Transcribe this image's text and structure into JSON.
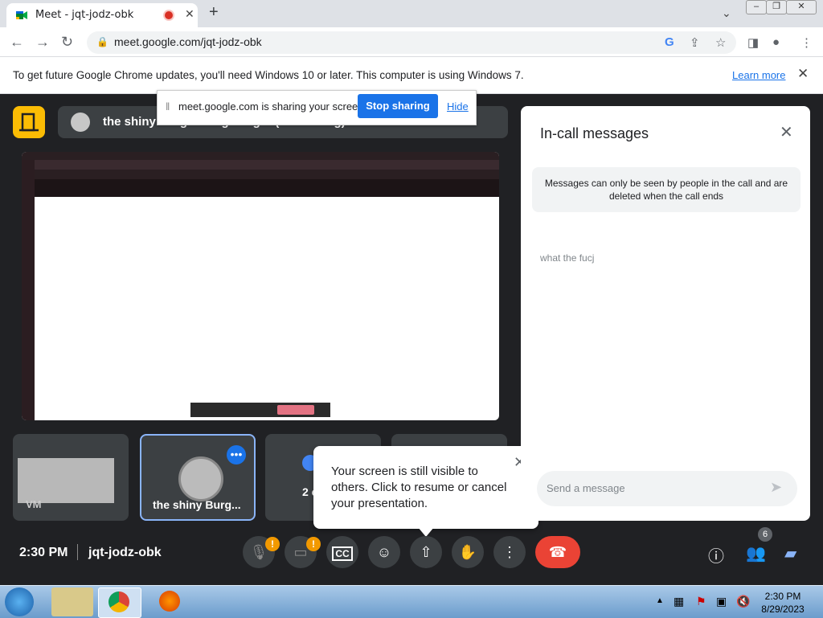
{
  "browser": {
    "tab_title": "Meet - jqt-jodz-obk",
    "new_tab_icon": "+",
    "url": "meet.google.com/jqt-jodz-obk",
    "infobar_text": "To get future Google Chrome updates, you'll need Windows 10 or later. This computer is using Windows 7.",
    "infobar_link": "Learn more"
  },
  "sharebar": {
    "text": "meet.google.com is sharing your screen.",
    "stop_label": "Stop sharing",
    "hide_label": "Hide"
  },
  "meet": {
    "presenter_name": "the shiny Burger King Burger (Presenting)",
    "tiles": [
      {
        "label": "VM"
      },
      {
        "label": "the shiny Burg..."
      },
      {
        "label": "2 c"
      }
    ],
    "popup_text": "Your screen is still visible to others. Click to resume or cancel your presentation.",
    "clock": "2:30 PM",
    "meeting_code": "jqt-jodz-obk",
    "participant_count": "6",
    "mic_badge": "!",
    "cam_badge": "!"
  },
  "panel": {
    "title": "In-call messages",
    "info": "Messages can only be seen by people in the call and are deleted when the call ends",
    "messages": [
      "what the fucj"
    ],
    "input_placeholder": "Send a message"
  },
  "taskbar": {
    "time": "2:30 PM",
    "date": "8/29/2023"
  }
}
